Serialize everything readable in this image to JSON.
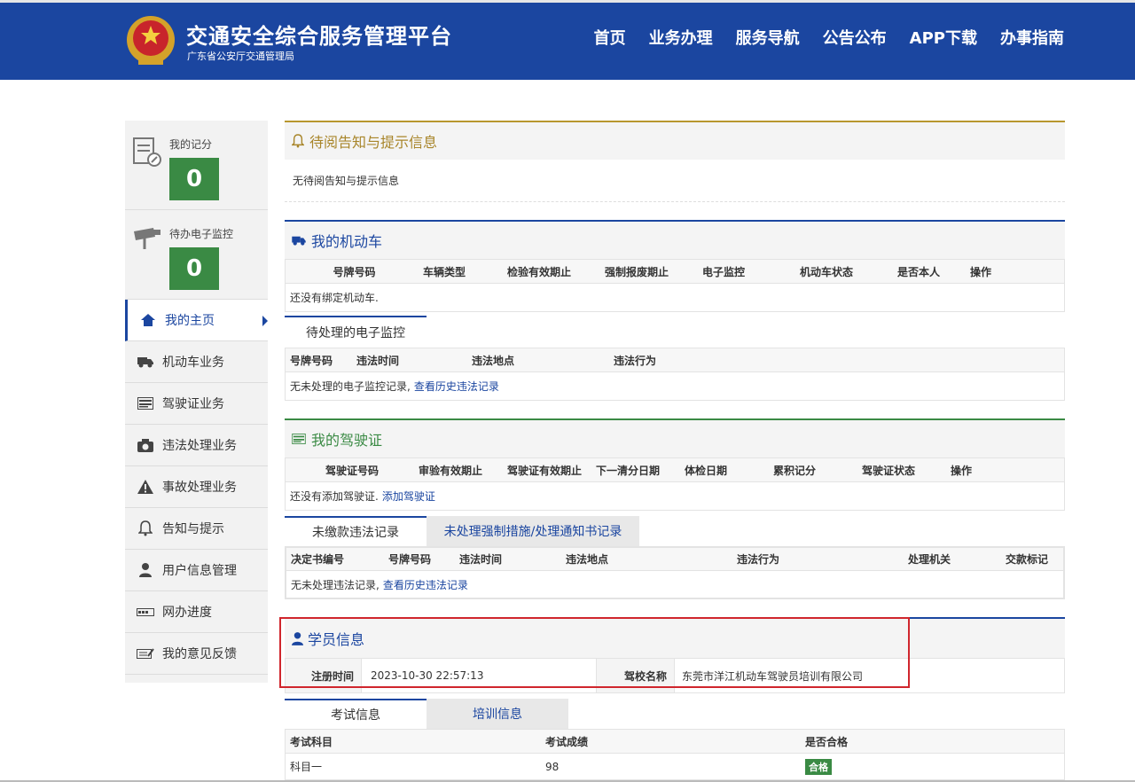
{
  "header": {
    "title": "交通安全综合服务管理平台",
    "subtitle": "广东省公安厅交通管理局",
    "nav": [
      "首页",
      "业务办理",
      "服务导航",
      "公告公布",
      "APP下载",
      "办事指南"
    ]
  },
  "sidebar": {
    "score_label": "我的记分",
    "score_value": "0",
    "monitor_label": "待办电子监控",
    "monitor_value": "0",
    "items": [
      {
        "label": "我的主页",
        "icon": "home-icon"
      },
      {
        "label": "机动车业务",
        "icon": "truck-icon"
      },
      {
        "label": "驾驶证业务",
        "icon": "card-icon"
      },
      {
        "label": "违法处理业务",
        "icon": "camera-icon"
      },
      {
        "label": "事故处理业务",
        "icon": "warning-icon"
      },
      {
        "label": "告知与提示",
        "icon": "bell-icon"
      },
      {
        "label": "用户信息管理",
        "icon": "user-icon"
      },
      {
        "label": "网办进度",
        "icon": "progress-icon"
      },
      {
        "label": "我的意见反馈",
        "icon": "feedback-icon"
      }
    ]
  },
  "notice": {
    "title": "待阅告知与提示信息",
    "empty": "无待阅告知与提示信息"
  },
  "vehicles": {
    "title": "我的机动车",
    "columns": [
      "号牌号码",
      "车辆类型",
      "检验有效期止",
      "强制报废期止",
      "电子监控",
      "机动车状态",
      "是否本人",
      "操作"
    ],
    "empty": "还没有绑定机动车."
  },
  "monitoring": {
    "tab": "待处理的电子监控",
    "columns": [
      "号牌号码",
      "违法时间",
      "违法地点",
      "违法行为"
    ],
    "empty": "无未处理的电子监控记录,",
    "history_link": "查看历史违法记录"
  },
  "license": {
    "title": "我的驾驶证",
    "columns": [
      "驾驶证号码",
      "审验有效期止",
      "驾驶证有效期止",
      "下一清分日期",
      "体检日期",
      "累积记分",
      "驾驶证状态",
      "操作"
    ],
    "empty": "还没有添加驾驶证.",
    "add_link": "添加驾驶证"
  },
  "violations": {
    "tabs": [
      "未缴款违法记录",
      "未处理强制措施/处理通知书记录"
    ],
    "columns": [
      "决定书编号",
      "号牌号码",
      "违法时间",
      "违法地点",
      "违法行为",
      "处理机关",
      "交款标记"
    ],
    "empty": "无未处理违法记录,",
    "history_link": "查看历史违法记录"
  },
  "student": {
    "title": "学员信息",
    "reg_label": "注册时间",
    "reg_value": "2023-10-30 22:57:13",
    "school_label": "驾校名称",
    "school_value": "东莞市洋江机动车驾驶员培训有限公司"
  },
  "exam": {
    "tabs": [
      "考试信息",
      "培训信息"
    ],
    "columns": [
      "考试科目",
      "考试成绩",
      "是否合格"
    ],
    "rows": [
      {
        "subject": "科目一",
        "score": "98",
        "result": "合格"
      }
    ]
  },
  "colors": {
    "brand": "#1b46a0",
    "green": "#3a8a44",
    "highlight": "#d0262d"
  }
}
